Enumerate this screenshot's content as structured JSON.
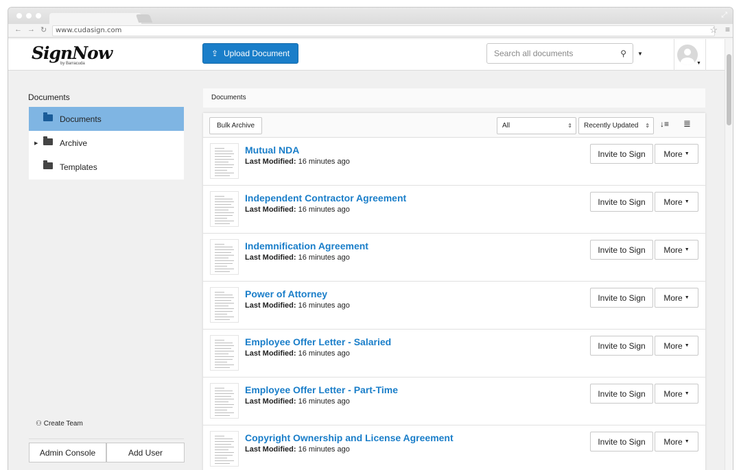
{
  "browser": {
    "url": "www.cudasign.com"
  },
  "header": {
    "logo": "SignNow",
    "logo_sub": "by Barracuda",
    "upload_label": "Upload Document",
    "search_placeholder": "Search all documents"
  },
  "sidebar": {
    "title": "Documents",
    "folders": [
      {
        "label": "Documents",
        "active": true
      },
      {
        "label": "Archive",
        "active": false
      },
      {
        "label": "Templates",
        "active": false
      }
    ],
    "create_team": "Create Team",
    "admin_console": "Admin Console",
    "add_user": "Add User"
  },
  "main": {
    "breadcrumb": "Documents",
    "bulk_archive": "Bulk Archive",
    "filter_value": "All",
    "sort_value": "Recently Updated",
    "meta_label": "Last Modified:",
    "invite_label": "Invite to Sign",
    "more_label": "More",
    "documents": [
      {
        "title": "Mutual NDA",
        "modified": "16 minutes ago"
      },
      {
        "title": "Independent Contractor Agreement",
        "modified": "16 minutes ago"
      },
      {
        "title": "Indemnification Agreement",
        "modified": "16 minutes ago"
      },
      {
        "title": "Power of Attorney",
        "modified": "16 minutes ago"
      },
      {
        "title": "Employee Offer Letter - Salaried",
        "modified": "16 minutes ago"
      },
      {
        "title": "Employee Offer Letter - Part-Time",
        "modified": "16 minutes ago"
      },
      {
        "title": "Copyright Ownership and License Agreement",
        "modified": "16 minutes ago"
      }
    ]
  },
  "colors": {
    "accent": "#1a7ec9",
    "active_folder": "#7fb5e3"
  }
}
